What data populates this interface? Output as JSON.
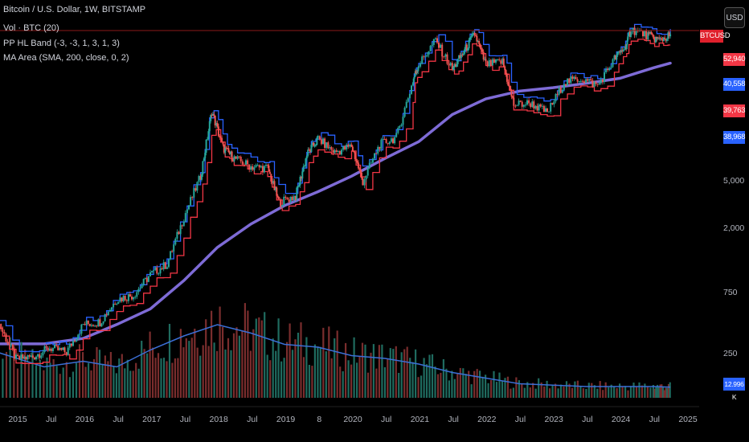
{
  "header": {
    "title": "Bitcoin / U.S. Dollar, 1W, BITSTAMP",
    "indicators": [
      "Vol · BTC (20)",
      "PP HL Band (-3, -3, 1, 3, 1, 3)",
      "MA Area (SMA, 200, close, 0, 2)"
    ]
  },
  "currency_button": "USD",
  "price_labels": {
    "symbol": "BTCUSD",
    "p1": "52,940",
    "p2": "40,558",
    "p3": "39,763",
    "p4": "38,968",
    "volume": "12.996 K"
  },
  "colors": {
    "background": "#000000",
    "band_high": "#2962ff",
    "band_low": "#f23645",
    "candle_up": "#26a69a",
    "candle_down": "#ef5350",
    "ma": "#7e6bd6",
    "volume_ma": "#3b6fd6",
    "hline": "#8b1a1a"
  },
  "chart_data": {
    "type": "line",
    "y_scale": "log",
    "x_ticks": [
      "2015",
      "Jul",
      "2016",
      "Jul",
      "2017",
      "Jul",
      "2018",
      "Jul",
      "2019",
      "8",
      "2020",
      "Jul",
      "2021",
      "Jul",
      "2022",
      "Jul",
      "2023",
      "Jul",
      "2024",
      "Jul",
      "2025"
    ],
    "y_ticks": [
      "5,000",
      "2,000",
      "750",
      "250"
    ],
    "series": [
      {
        "name": "Bitcoin / U.S. Dollar",
        "x": [
          "2014-10",
          "2015-01",
          "2015-04",
          "2015-07",
          "2015-10",
          "2016-01",
          "2016-04",
          "2016-07",
          "2016-10",
          "2017-01",
          "2017-04",
          "2017-07",
          "2017-10",
          "2017-12",
          "2018-02",
          "2018-04",
          "2018-07",
          "2018-10",
          "2018-12",
          "2019-03",
          "2019-05",
          "2019-07",
          "2019-10",
          "2020-01",
          "2020-03",
          "2020-06",
          "2020-09",
          "2020-12",
          "2021-01",
          "2021-04",
          "2021-07",
          "2021-09",
          "2021-11",
          "2022-01",
          "2022-04",
          "2022-06",
          "2022-09",
          "2022-12",
          "2023-03",
          "2023-06",
          "2023-09",
          "2023-12",
          "2024-02",
          "2024-03",
          "2024-06",
          "2024-08",
          "2024-10"
        ],
        "values": [
          420,
          230,
          240,
          280,
          260,
          420,
          440,
          650,
          700,
          1000,
          1200,
          2700,
          5500,
          17000,
          9000,
          7500,
          6500,
          6300,
          3500,
          3900,
          8000,
          10500,
          8300,
          9300,
          5000,
          9500,
          10800,
          29000,
          38000,
          58000,
          35000,
          47000,
          65000,
          38000,
          40000,
          19000,
          19500,
          16500,
          28000,
          30000,
          26500,
          42000,
          52000,
          70000,
          63000,
          58000,
          63000
        ]
      },
      {
        "name": "MA Area (SMA, 200)",
        "x": [
          "2014-10",
          "2015-06",
          "2016-01",
          "2016-07",
          "2017-01",
          "2017-07",
          "2018-01",
          "2018-07",
          "2019-01",
          "2019-07",
          "2020-01",
          "2020-07",
          "2021-01",
          "2021-07",
          "2022-01",
          "2022-07",
          "2023-01",
          "2023-07",
          "2024-01",
          "2024-07",
          "2024-10"
        ],
        "values": [
          300,
          300,
          330,
          420,
          550,
          900,
          1600,
          2400,
          3300,
          4200,
          5500,
          7500,
          10000,
          16000,
          21000,
          24000,
          25500,
          27500,
          30000,
          36000,
          39000
        ]
      }
    ],
    "volume": {
      "name": "Vol · BTC (20)",
      "x": [
        "2014-10",
        "2015-06",
        "2016-01",
        "2016-07",
        "2017-01",
        "2017-07",
        "2018-01",
        "2018-07",
        "2019-01",
        "2019-07",
        "2020-01",
        "2020-07",
        "2021-01",
        "2021-07",
        "2022-01",
        "2022-07",
        "2023-01",
        "2023-07",
        "2024-01",
        "2024-07",
        "2024-10"
      ],
      "values": [
        160,
        110,
        130,
        110,
        170,
        220,
        260,
        230,
        190,
        180,
        150,
        140,
        120,
        90,
        70,
        50,
        45,
        40,
        40,
        40,
        38
      ]
    }
  }
}
